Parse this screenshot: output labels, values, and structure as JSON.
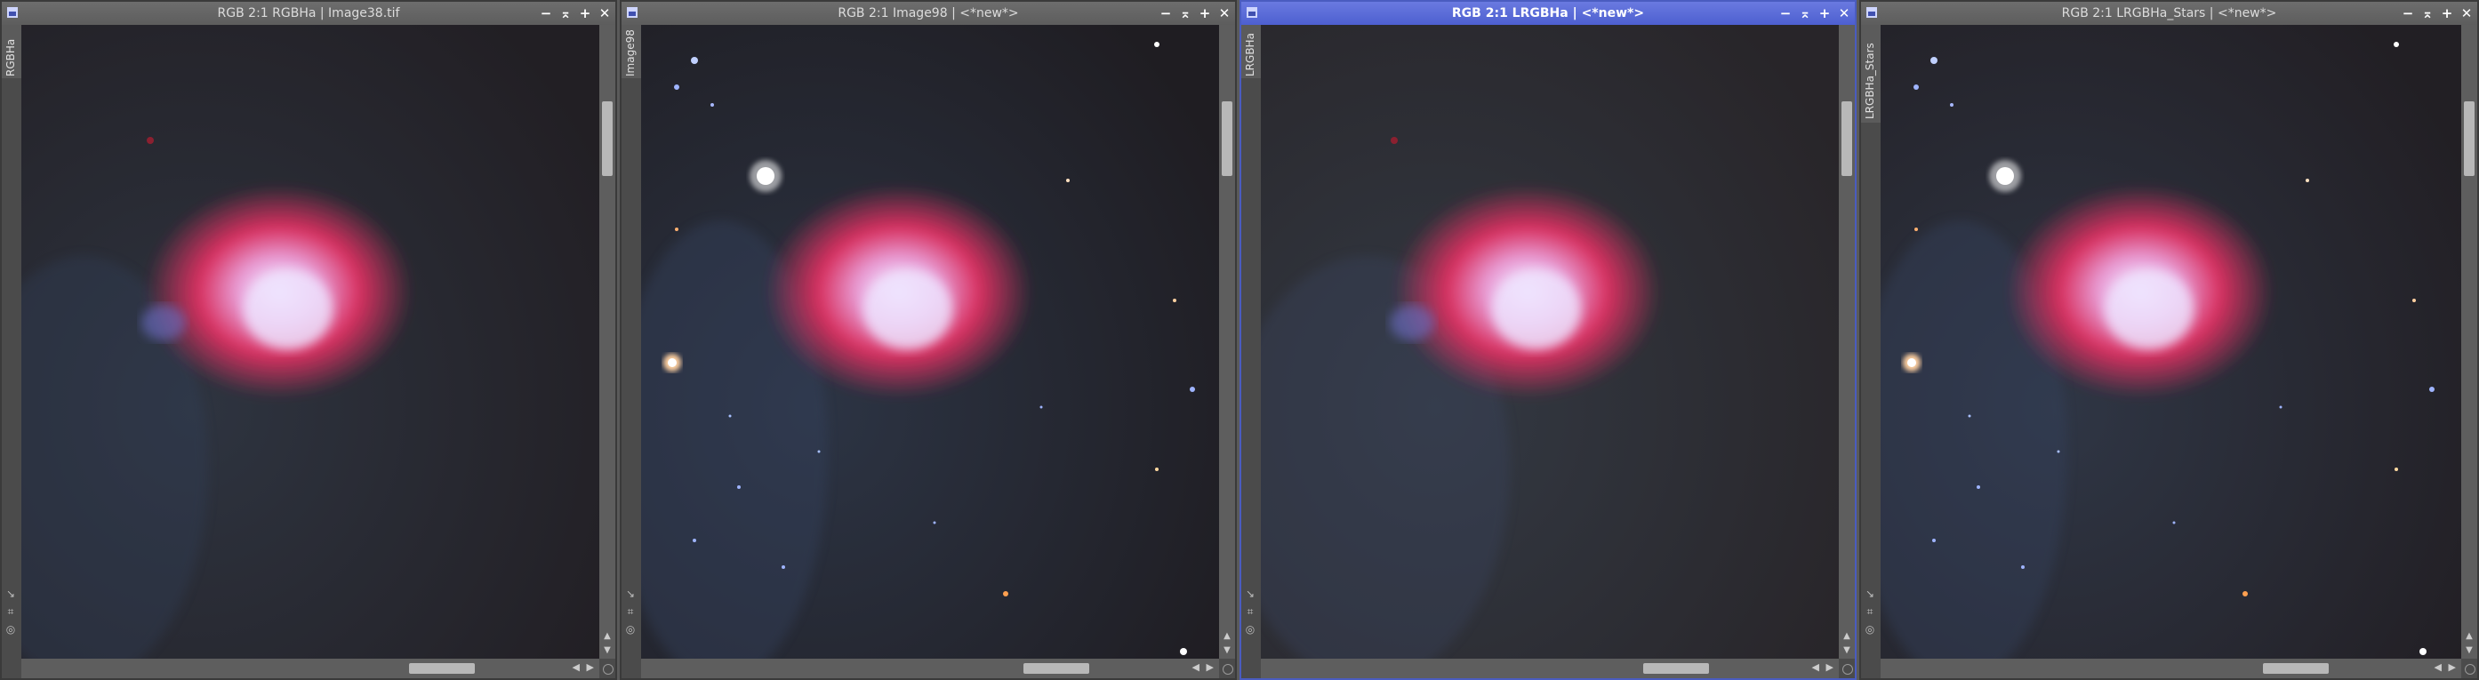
{
  "windows": [
    {
      "title": "RGB 2:1 RGBHa | Image38.tif",
      "side_tab": "RGBHa",
      "active": false,
      "stars": false
    },
    {
      "title": "RGB 2:1 Image98 | <*new*>",
      "side_tab": "Image98",
      "active": false,
      "stars": true
    },
    {
      "title": "RGB 2:1 LRGBHa | <*new*>",
      "side_tab": "LRGBHa",
      "active": true,
      "stars": false
    },
    {
      "title": "RGB 2:1 LRGBHa_Stars | <*new*>",
      "side_tab": "LRGBHa_Stars",
      "active": false,
      "stars": true
    }
  ],
  "controls": {
    "minimize": "−",
    "shade": "⌅",
    "maximize": "+",
    "close": "✕"
  },
  "icons": [
    "window-icon",
    "minimize-icon",
    "shade-icon",
    "maximize-icon",
    "close-icon",
    "zoom-fit-icon",
    "crop-icon",
    "preview-icon"
  ],
  "colors": {
    "active_title": "#4d5fd0",
    "nebula": "#e0305a",
    "background": "#26262b"
  }
}
